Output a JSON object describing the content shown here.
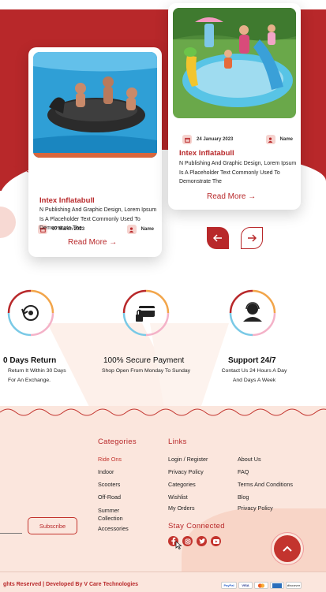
{
  "blog": {
    "cards": [
      {
        "date": "07 March 2023",
        "author": "Name",
        "title": "Intex Inflatabull",
        "text": "N Publishing And Graphic Design, Lorem Ipsum Is A Placeholder Text Commonly Used To Demonstrate The",
        "read_more": "Read More →"
      },
      {
        "date": "24 January 2023",
        "author": "Name",
        "title": "Intex Inflatabull",
        "text": "N Publishing And Graphic Design, Lorem Ipsum Is A Placeholder Text Commonly Used To Demonstrate The",
        "read_more": "Read More →"
      }
    ],
    "nav": {
      "prev_icon": "arrow-left-icon",
      "next_icon": "arrow-right-icon"
    }
  },
  "features": [
    {
      "title": "0 Days Return",
      "sub1": "Return It Within 30 Days",
      "sub2": "For An Exchange.",
      "icon": "return-icon"
    },
    {
      "title": "100%  Secure Payment",
      "sub1": "Shop Open From Monday To Sunday",
      "sub2": "",
      "icon": "secure-payment-icon"
    },
    {
      "title": "Support 24/7",
      "sub1": "Contact Us 24 Hours A Day",
      "sub2": "And Days A Week",
      "icon": "support-icon"
    }
  ],
  "footer": {
    "subscribe_label": "Subscribe",
    "categories": {
      "heading": "Categories",
      "items": [
        "Ride Ons",
        "Indoor",
        "Scooters",
        "Off-Road",
        "Summer Collection",
        "Accessories"
      ]
    },
    "links": {
      "heading": "Links",
      "col1": [
        "Login / Register",
        "Privacy Policy",
        "Categories",
        "Wishlist",
        "My Orders"
      ],
      "col2": [
        "About Us",
        "FAQ",
        "Terms And Conditions",
        "Blog",
        "Privacy Policy"
      ]
    },
    "stay_connected": "Stay Connected",
    "social": [
      "facebook-icon",
      "instagram-icon",
      "twitter-icon",
      "youtube-icon"
    ],
    "copyright": "ghts Reserved | Developed By V Care Technologies",
    "payments": [
      "PayPal",
      "VISA",
      "",
      "",
      "discover"
    ]
  },
  "colors": {
    "brand": "#b8282a",
    "footer_bg": "#fbe6dd"
  }
}
